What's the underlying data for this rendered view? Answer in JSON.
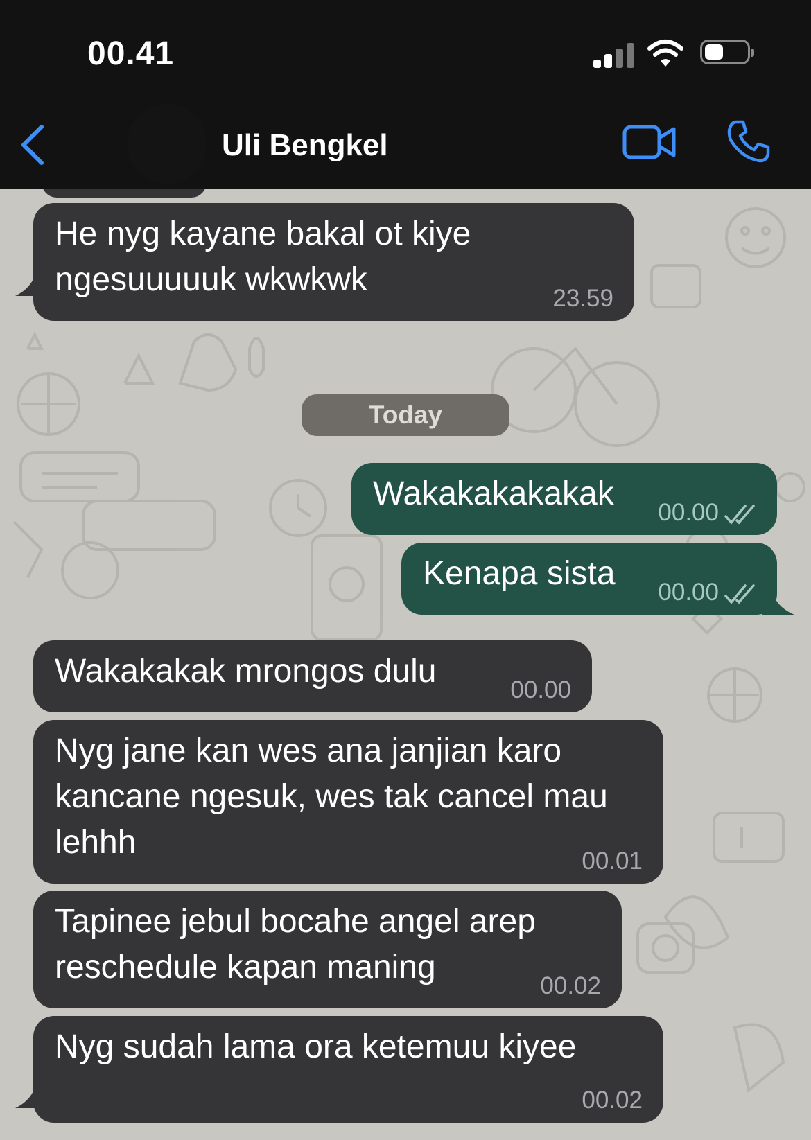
{
  "status_bar": {
    "time": "00.41"
  },
  "header": {
    "contact_name": "Uli Bengkel"
  },
  "date_divider": "Today",
  "messages": [
    {
      "direction": "incoming",
      "text": "He nyg kayane bakal ot kiye ngesuuuuuk wkwkwk",
      "time": "23.59"
    },
    {
      "direction": "outgoing",
      "text": "Wakakakakakak",
      "time": "00.00",
      "status": "read"
    },
    {
      "direction": "outgoing",
      "text": "Kenapa sista",
      "time": "00.00",
      "status": "read"
    },
    {
      "direction": "incoming",
      "text": "Wakakakak mrongos dulu",
      "time": "00.00"
    },
    {
      "direction": "incoming",
      "text": "Nyg jane kan wes ana janjian karo kancane ngesuk, wes tak cancel mau lehhh",
      "time": "00.01"
    },
    {
      "direction": "incoming",
      "text": "Tapinee jebul bocahe angel arep reschedule kapan maning",
      "time": "00.02"
    },
    {
      "direction": "incoming",
      "text": "Nyg sudah lama ora ketemuu kiyee",
      "time": "00.02"
    }
  ],
  "colors": {
    "header_bg": "#121212",
    "accent": "#3d8ef7",
    "chat_bg": "#c9c7c2",
    "incoming_bubble": "#353538",
    "outgoing_bubble": "#235346"
  },
  "icons": [
    "back-chevron-icon",
    "video-call-icon",
    "phone-icon",
    "double-check-icon",
    "signal-icon",
    "wifi-icon",
    "battery-icon"
  ]
}
